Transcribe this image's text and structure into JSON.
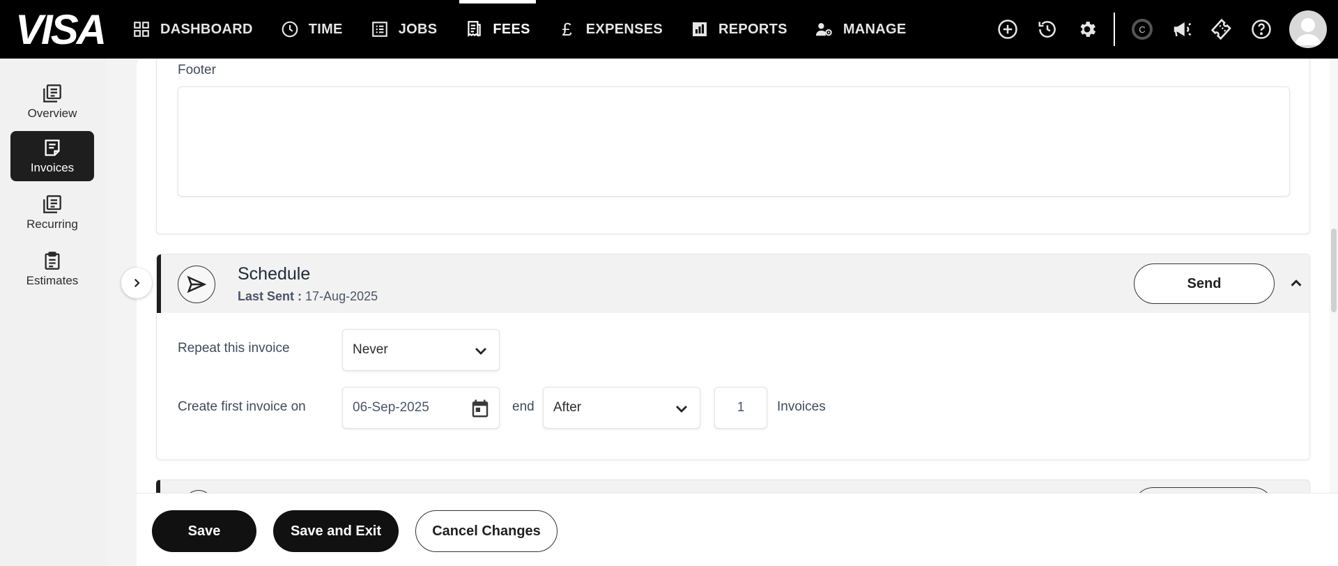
{
  "brand": {
    "logo_text": "VISA"
  },
  "nav": {
    "items": [
      {
        "label": "DASHBOARD",
        "icon": "dashboard-icon"
      },
      {
        "label": "TIME",
        "icon": "clock-icon"
      },
      {
        "label": "JOBS",
        "icon": "list-icon"
      },
      {
        "label": "FEES",
        "icon": "receipt-icon",
        "active": true
      },
      {
        "label": "EXPENSES",
        "icon": "pound-icon"
      },
      {
        "label": "REPORTS",
        "icon": "bar-chart-icon"
      },
      {
        "label": "MANAGE",
        "icon": "user-gear-icon"
      }
    ],
    "right_icons": [
      "add-circle-icon",
      "history-icon",
      "settings-icon",
      "copyright-icon",
      "megaphone-icon",
      "ticket-icon",
      "help-icon",
      "avatar"
    ]
  },
  "sidebar": {
    "items": [
      {
        "label": "Overview",
        "icon": "overview-icon"
      },
      {
        "label": "Invoices",
        "icon": "invoice-icon",
        "active": true
      },
      {
        "label": "Recurring",
        "icon": "recurring-icon"
      },
      {
        "label": "Estimates",
        "icon": "clipboard-icon"
      }
    ]
  },
  "footer_section": {
    "label": "Footer",
    "value": ""
  },
  "schedule": {
    "title": "Schedule",
    "last_sent_label": "Last Sent :",
    "last_sent_value": "17-Aug-2025",
    "send_label": "Send",
    "repeat_label": "Repeat this invoice",
    "repeat_value": "Never",
    "create_label": "Create first invoice on",
    "create_date": "06-Sep-2025",
    "end_label": "end",
    "end_value": "After",
    "count_value": "1",
    "count_unit": "Invoices"
  },
  "actions": {
    "save": "Save",
    "save_exit": "Save and Exit",
    "cancel": "Cancel Changes"
  }
}
